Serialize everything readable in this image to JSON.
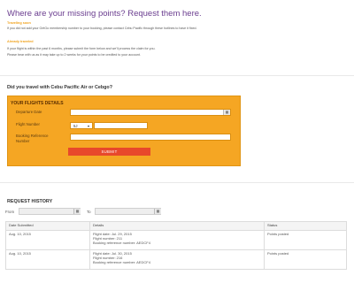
{
  "header": {
    "title": "Where are your missing points? Request them here."
  },
  "notice1": {
    "label": "Traveling soon",
    "text": "If you did not add your GetGo membership number to your booking, please contact Cebu Pacific through these hotlines to have it fixed."
  },
  "notice2": {
    "label": "Already traveled",
    "line1": "If your flight is within the past 6 months, please submit the form below and we'll process the claim for you.",
    "line2": "Please bear with us as it may take up to 2 weeks for your points to be credited to your account."
  },
  "question": "Did you travel with Cebu Pacific Air or Cebgo?",
  "flight_form": {
    "title": "YOUR FLIGHTS DETAILS",
    "departure_label": "Departure Date",
    "flight_number_label": "Flight Number",
    "airline_code": "5J",
    "booking_label_1": "Booking Reference",
    "booking_label_2": "Number",
    "submit_label": "SUBMIT",
    "calendar_icon": "calendar-icon"
  },
  "history": {
    "title": "REQUEST HISTORY",
    "from_label": "From",
    "to_label": "To",
    "columns": [
      "Date Submitted",
      "Details",
      "Status"
    ],
    "rows": [
      {
        "date": "Aug. 10, 2015",
        "details": [
          "Flight date: Jul. 29, 2015",
          "Flight number: 211",
          "Booking reference number: AEDCF4"
        ],
        "status": "Points posted"
      },
      {
        "date": "Aug. 10, 2015",
        "details": [
          "Flight date: Jul. 30, 2015",
          "Flight number: 216",
          "Booking reference number: AEDCF4"
        ],
        "status": "Points posted"
      }
    ]
  },
  "colors": {
    "accent_purple": "#6a3d8f",
    "panel_orange": "#f5a623",
    "submit_red": "#e8482b",
    "label_orange": "#f0a21c"
  }
}
